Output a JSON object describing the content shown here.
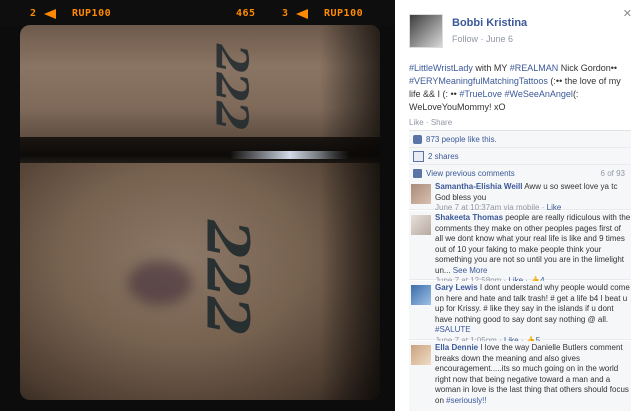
{
  "film": {
    "frame_left": "2",
    "code_left": "RUP100",
    "number_mid": "465",
    "frame_right": "3",
    "code_right": "RUP100"
  },
  "photo": {
    "tattoo_text": "222"
  },
  "post": {
    "author": "Bobbi Kristina",
    "follow": "Follow",
    "date": "June 6",
    "caption_parts": [
      {
        "text": "#LittleWristLady",
        "tag": true
      },
      {
        "text": " with MY ",
        "tag": false
      },
      {
        "text": "#REALMAN",
        "tag": true
      },
      {
        "text": " Nick Gordon•• ",
        "tag": false
      },
      {
        "text": "#VERYMeaningfulMatchingTattoos",
        "tag": true
      },
      {
        "text": " (:•• the love of my life && I (: •• ",
        "tag": false
      },
      {
        "text": "#TrueLove",
        "tag": true
      },
      {
        "text": " ",
        "tag": false
      },
      {
        "text": "#WeSeeAnAngel",
        "tag": true
      },
      {
        "text": "(: WeLoveYouMommy! xO",
        "tag": false
      }
    ],
    "like_label": "Like",
    "share_label": "Share",
    "likes_text": "873 people like this.",
    "shares_text": "2 shares",
    "view_previous": "View previous comments",
    "comments_count": "6 of 93"
  },
  "comments": [
    {
      "name": "Samantha-Elishia Weill",
      "text": " Aww u so sweet love ya tc God bless you",
      "meta": "June 7 at 10:37am via mobile · ",
      "like": "Like",
      "likes": ""
    },
    {
      "name": "Shakeeta Thomas",
      "text": " people are really ridiculous with the comments they make on other peoples pages first of all we dont know what your real life is like and 9 times out of 10 your faking to make people think your something you are not so until you are in the limelight un... ",
      "see_more": "See More",
      "meta": "June 7 at 12:58pm · ",
      "like": "Like",
      "likes": "4"
    },
    {
      "name": "Gary Lewis",
      "text": " I dont understand why people would come on here and hate and talk trash! # get a life b4 I beat u up for Krissy. # like they say in the islands if u dont have nothing good to say dont say nothing @ all.",
      "hashtag": "#SALUTE",
      "meta": "June 7 at 1:05pm · ",
      "like": "Like",
      "likes": "5"
    },
    {
      "name": "Ella Dennie",
      "text": " I love the way Danielle Butlers comment breaks down the meaning and also gives encouragement.....its so much going on in the world right now that being negative toward a man and a woman in love is the last thing that others should focus on",
      "hashtag": "#seriously!!",
      "meta": "",
      "like": "",
      "likes": ""
    }
  ],
  "colors": {
    "film_orange": "#ff8a00",
    "fb_blue": "#3b5998",
    "meta_gray": "#9197a3"
  }
}
